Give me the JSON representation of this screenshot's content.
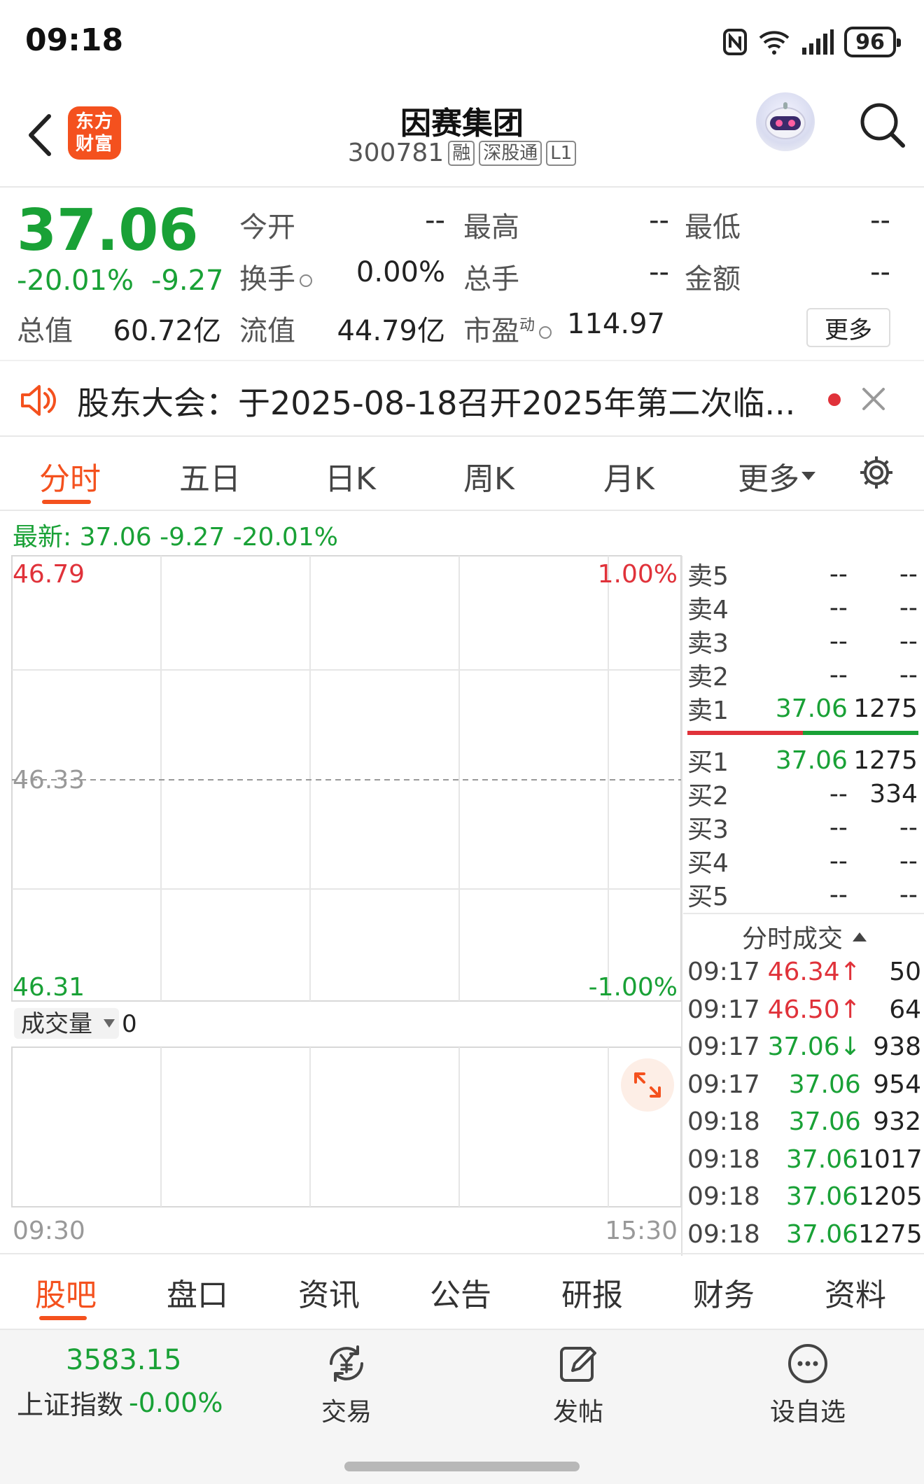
{
  "status": {
    "time": "09:18",
    "battery": "96"
  },
  "header": {
    "logo": [
      "东方",
      "财富"
    ],
    "stock_name": "因赛集团",
    "stock_code": "300781",
    "tags": [
      "融",
      "深股通",
      "L1"
    ]
  },
  "quote": {
    "price": "37.06",
    "pct": "-20.01%",
    "change": "-9.27",
    "open_label": "今开",
    "open": "--",
    "high_label": "最高",
    "high": "--",
    "low_label": "最低",
    "low": "--",
    "turnover_label": "换手",
    "turnover": "0.00%",
    "volume_label": "总手",
    "volume": "--",
    "amount_label": "金额",
    "amount": "--",
    "mcap_label": "总值",
    "mcap": "60.72亿",
    "float_label": "流值",
    "float": "44.79亿",
    "pe_label": "市盈",
    "pe_sup": "动",
    "pe": "114.97",
    "more": "更多"
  },
  "notice": {
    "text": "股东大会：于2025-08-18召开2025年第二次临..."
  },
  "period_tabs": [
    "分时",
    "五日",
    "日K",
    "周K",
    "月K",
    "更多"
  ],
  "chart": {
    "latest": "最新: 37.06 -9.27 -20.01%",
    "y_top": "46.79",
    "y_mid": "46.33",
    "y_bottom": "46.31",
    "pct_top": "1.00%",
    "pct_bottom": "-1.00%",
    "volume_label": "成交量",
    "volume_value": "0",
    "x_start": "09:30",
    "x_end": "15:30"
  },
  "order_book": {
    "asks": [
      {
        "label": "卖5",
        "price": "--",
        "vol": "--"
      },
      {
        "label": "卖4",
        "price": "--",
        "vol": "--"
      },
      {
        "label": "卖3",
        "price": "--",
        "vol": "--"
      },
      {
        "label": "卖2",
        "price": "--",
        "vol": "--"
      },
      {
        "label": "卖1",
        "price": "37.06",
        "vol": "1275"
      }
    ],
    "bids": [
      {
        "label": "买1",
        "price": "37.06",
        "vol": "1275"
      },
      {
        "label": "买2",
        "price": "--",
        "vol": "334"
      },
      {
        "label": "买3",
        "price": "--",
        "vol": "--"
      },
      {
        "label": "买4",
        "price": "--",
        "vol": "--"
      },
      {
        "label": "买5",
        "price": "--",
        "vol": "--"
      }
    ]
  },
  "trades": {
    "title": "分时成交",
    "rows": [
      {
        "time": "09:17",
        "price": "46.34↑",
        "vol": "50",
        "color": "red"
      },
      {
        "time": "09:17",
        "price": "46.50↑",
        "vol": "64",
        "color": "red"
      },
      {
        "time": "09:17",
        "price": "37.06↓",
        "vol": "938",
        "color": "green"
      },
      {
        "time": "09:17",
        "price": "37.06",
        "vol": "954",
        "color": "green"
      },
      {
        "time": "09:18",
        "price": "37.06",
        "vol": "932",
        "color": "green"
      },
      {
        "time": "09:18",
        "price": "37.06",
        "vol": "1017",
        "color": "green"
      },
      {
        "time": "09:18",
        "price": "37.06",
        "vol": "1205",
        "color": "green"
      },
      {
        "time": "09:18",
        "price": "37.06",
        "vol": "1275",
        "color": "green"
      }
    ]
  },
  "bottom_tabs": [
    "股吧",
    "盘口",
    "资讯",
    "公告",
    "研报",
    "财务",
    "资料"
  ],
  "bottom_bar": {
    "index_value": "3583.15",
    "index_name": "上证指数",
    "index_pct": "-0.00%",
    "trade": "交易",
    "post": "发帖",
    "watchlist": "设自选"
  },
  "colors": {
    "accent": "#f4511e",
    "up": "#e0323a",
    "down": "#19a136"
  }
}
